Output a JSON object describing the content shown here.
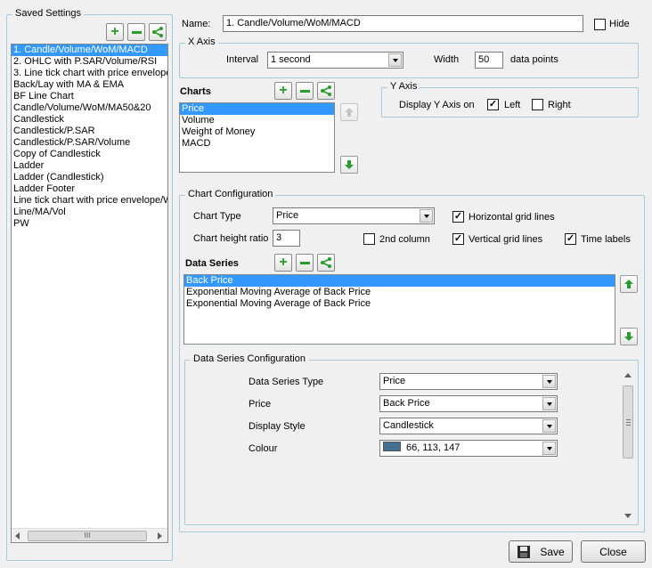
{
  "saved_settings": {
    "title": "Saved Settings",
    "items": [
      "1. Candle/Volume/WoM/MACD",
      "2. OHLC with P.SAR/Volume/RSI",
      "3. Line tick chart with price envelope",
      "Back/Lay with MA & EMA",
      "BF Line Chart",
      "Candle/Volume/WoM/MA50&20",
      "Candlestick",
      "Candlestick/P.SAR",
      "Candlestick/P.SAR/Volume",
      "Copy of Candlestick",
      "Ladder",
      "Ladder (Candlestick)",
      "Ladder Footer",
      "Line tick chart with price envelope/W",
      "Line/MA/Vol",
      "PW"
    ],
    "selected_index": 0,
    "hscroll_thumb": "III"
  },
  "name": {
    "label": "Name:",
    "value": "1. Candle/Volume/WoM/MACD",
    "hide_label": "Hide",
    "hide_checked": false
  },
  "x_axis": {
    "title": "X Axis",
    "interval_label": "Interval",
    "interval_value": "1 second",
    "width_label": "Width",
    "width_value": "50",
    "width_unit": "data points"
  },
  "charts": {
    "title": "Charts",
    "items": [
      "Price",
      "Volume",
      "Weight of Money",
      "MACD"
    ],
    "selected_index": 0
  },
  "y_axis": {
    "title": "Y Axis",
    "display_label": "Display Y Axis on",
    "left_label": "Left",
    "left_checked": true,
    "right_label": "Right",
    "right_checked": false
  },
  "chart_config": {
    "title": "Chart Configuration",
    "chart_type_label": "Chart Type",
    "chart_type_value": "Price",
    "height_label": "Chart height ratio",
    "height_value": "3",
    "second_column_label": "2nd column",
    "second_column_checked": false,
    "hgrid_label": "Horizontal grid lines",
    "hgrid_checked": true,
    "vgrid_label": "Vertical grid lines",
    "vgrid_checked": true,
    "time_labels_label": "Time labels",
    "time_labels_checked": true
  },
  "data_series": {
    "title": "Data Series",
    "items": [
      "Back Price",
      "Exponential Moving Average of Back Price",
      "Exponential Moving Average of Back Price"
    ],
    "selected_index": 0
  },
  "ds_config": {
    "title": "Data Series Configuration",
    "rows": [
      {
        "label": "Data Series Type",
        "value": "Price"
      },
      {
        "label": "Price",
        "value": "Back Price"
      },
      {
        "label": "Display Style",
        "value": "Candlestick"
      },
      {
        "label": "Colour",
        "value": "66, 113, 147"
      }
    ],
    "colour_swatch": "#427193"
  },
  "buttons": {
    "save": "Save",
    "close": "Close"
  }
}
